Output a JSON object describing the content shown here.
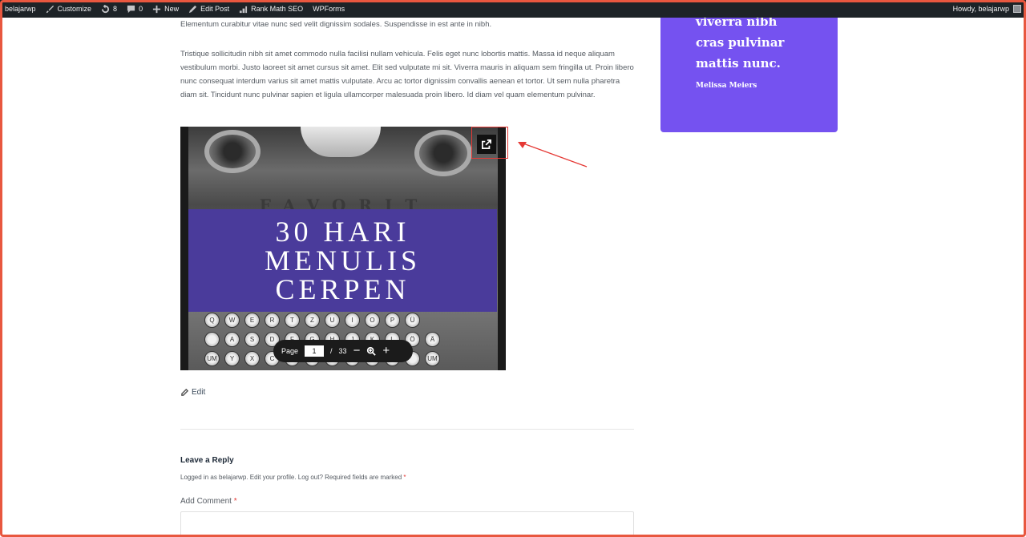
{
  "adminbar": {
    "items": [
      {
        "label": "belajarwp"
      },
      {
        "label": "Customize"
      },
      {
        "label": "8"
      },
      {
        "label": "0"
      },
      {
        "label": "New"
      },
      {
        "label": "Edit Post"
      },
      {
        "label": "Rank Math SEO"
      },
      {
        "label": "WPForms"
      }
    ],
    "howdy": "Howdy, belajarwp"
  },
  "article": {
    "para1": "Elementum curabitur vitae nunc sed velit dignissim sodales. Suspendisse in est ante in nibh.",
    "para2": "Tristique sollicitudin nibh sit amet commodo nulla facilisi nullam vehicula. Felis eget nunc lobortis mattis. Massa id neque aliquam vestibulum morbi. Justo laoreet sit amet cursus sit amet. Elit sed vulputate mi sit. Viverra mauris in aliquam sem fringilla ut. Proin libero nunc consequat interdum varius sit amet mattis vulputate. Arcu ac tortor dignissim convallis aenean et tortor. Ut sem nulla pharetra diam sit. Tincidunt nunc pulvinar sapien et ligula ullamcorper malesuada proin libero. Id diam vel quam elementum pulvinar."
  },
  "pdf": {
    "brand": "FAVORIT",
    "cover_lines": [
      "30 HARI",
      "MENULIS",
      "CERPEN"
    ],
    "page_label": "Page",
    "current_page": "1",
    "separator": "/",
    "total_pages": "33",
    "key_rows": [
      [
        "Q",
        "W",
        "E",
        "R",
        "T",
        "Z",
        "U",
        "I",
        "O",
        "P",
        "Ü"
      ],
      [
        "",
        "A",
        "S",
        "D",
        "F",
        "G",
        "H",
        "J",
        "K",
        "L",
        "Ö",
        "Ä"
      ],
      [
        "UM",
        "Y",
        "X",
        "C",
        "V",
        "B",
        "N",
        "M",
        "",
        "",
        "",
        "UM"
      ]
    ]
  },
  "post": {
    "edit_label": "Edit"
  },
  "comments": {
    "title": "Leave a Reply",
    "logged_in": "Logged in as belajarwp. Edit your profile. Log out? Required fields are marked",
    "required_mark": "*",
    "comment_label": "Add Comment"
  },
  "testimonial": {
    "quote": "viverra nibh\ncras pulvinar\nmattis nunc.",
    "author": "Melissa Meiers"
  },
  "colors": {
    "adminbar": "#1d2327",
    "card": "#7552f0",
    "cover_banner": "#4a3b9b",
    "highlight": "#e53935",
    "frame": "#e8573f"
  }
}
